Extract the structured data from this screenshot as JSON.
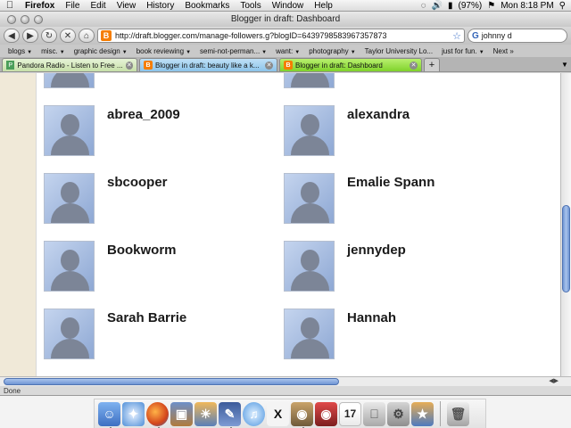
{
  "menubar": {
    "app": "Firefox",
    "menus": [
      "File",
      "Edit",
      "View",
      "History",
      "Bookmarks",
      "Tools",
      "Window",
      "Help"
    ],
    "battery": "(97%)",
    "clock": "Mon 8:18 PM"
  },
  "window": {
    "title": "Blogger in draft: Dashboard"
  },
  "navbar": {
    "url": "http://draft.blogger.com/manage-followers.g?blogID=6439798583967357873",
    "search_value": "johnny d"
  },
  "bookmarks": [
    "blogs",
    "misc.",
    "graphic design",
    "book reviewing",
    "semi-not-perman...",
    "want:",
    "photography",
    "Taylor University Lo...",
    "just for fun.",
    "Next »"
  ],
  "tabs": [
    {
      "label": "Pandora Radio - Listen to Free ...",
      "favicon": "P"
    },
    {
      "label": "Blogger in draft: beauty like a k...",
      "favicon": "B"
    },
    {
      "label": "Blogger in draft: Dashboard",
      "favicon": "B"
    }
  ],
  "new_tab_label": "+",
  "followers": [
    {
      "name": "abrea_2009"
    },
    {
      "name": "alexandra"
    },
    {
      "name": "sbcooper"
    },
    {
      "name": "Emalie Spann"
    },
    {
      "name": "Bookworm"
    },
    {
      "name": "jennydep"
    },
    {
      "name": "Sarah Barrie"
    },
    {
      "name": "Hannah"
    }
  ],
  "status": "Done",
  "dock": {
    "items": [
      "finder-icon",
      "safari-icon",
      "firefox-icon",
      "preview-icon",
      "iphoto-icon",
      "pen-app-icon",
      "itunes-icon",
      "x11-icon",
      "gimp-icon",
      "photo-booth-icon",
      "ical-icon",
      "apple-app-icon",
      "system-prefs-icon",
      "trash-icon"
    ],
    "ical_day": "17",
    "x11_label": "X"
  }
}
